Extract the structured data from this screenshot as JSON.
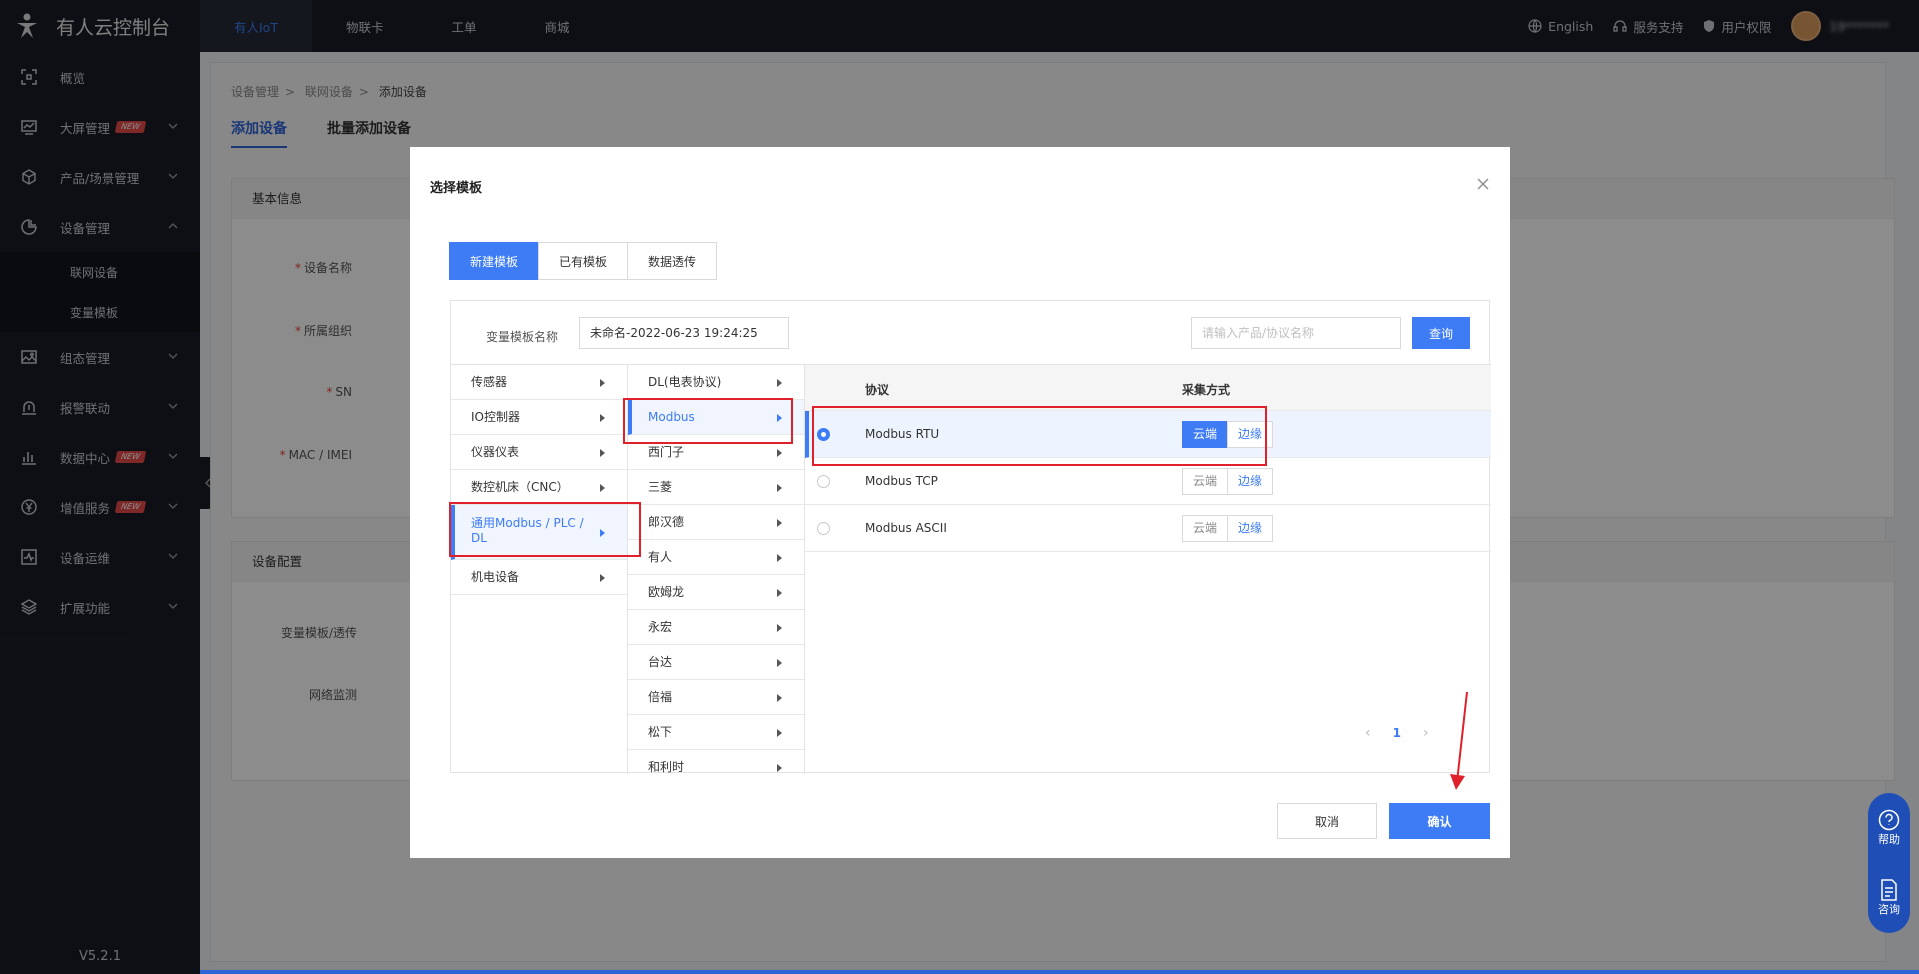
{
  "app": {
    "title": "有人云控制台",
    "version": "V5.2.1"
  },
  "topnav": {
    "tabs": [
      "有人IoT",
      "物联卡",
      "工单",
      "商城"
    ],
    "language": "English",
    "support": "服务支持",
    "permissions": "用户权限",
    "username": "19*******"
  },
  "sidebar": {
    "new_badge": "NEW",
    "items": [
      {
        "label": "概览"
      },
      {
        "label": "大屏管理"
      },
      {
        "label": "产品/场景管理"
      },
      {
        "label": "设备管理"
      },
      {
        "label": "组态管理"
      },
      {
        "label": "报警联动"
      },
      {
        "label": "数据中心"
      },
      {
        "label": "增值服务"
      },
      {
        "label": "设备运维"
      },
      {
        "label": "扩展功能"
      }
    ],
    "submenu": [
      "联网设备",
      "变量模板"
    ]
  },
  "page": {
    "breadcrumb": [
      "设备管理",
      "联网设备",
      "添加设备"
    ],
    "tabs": [
      "添加设备",
      "批量添加设备"
    ],
    "basic_info_title": "基本信息",
    "fields": [
      "设备名称",
      "所属组织",
      "SN",
      "MAC / IMEI"
    ],
    "device_config_title": "设备配置",
    "config_fields": [
      "变量模板/透传",
      "网络监测"
    ]
  },
  "modal": {
    "title": "选择模板",
    "segments": [
      "新建模板",
      "已有模板",
      "数据透传"
    ],
    "template_name_label": "变量模板名称",
    "template_name_value": "未命名-2022-06-23 19:24:25",
    "search_placeholder": "请输入产品/协议名称",
    "query_label": "查询",
    "categories": [
      "传感器",
      "IO控制器",
      "仪器仪表",
      "数控机床（CNC）",
      "通用Modbus / PLC / DL",
      "机电设备"
    ],
    "brands": [
      "DL(电表协议)",
      "Modbus",
      "西门子",
      "三菱",
      "郎汉德",
      "有人",
      "欧姆龙",
      "永宏",
      "台达",
      "倍福",
      "松下",
      "和利时"
    ],
    "table_headers": {
      "protocol": "协议",
      "mode": "采集方式"
    },
    "rows": [
      {
        "protocol": "Modbus RTU",
        "cloud": "云端",
        "edge": "边缘"
      },
      {
        "protocol": "Modbus TCP",
        "cloud": "云端",
        "edge": "边缘"
      },
      {
        "protocol": "Modbus ASCII",
        "cloud": "云端",
        "edge": "边缘"
      }
    ],
    "page_number": "1",
    "cancel_label": "取消",
    "confirm_label": "确认"
  },
  "float_help": {
    "help": "帮助",
    "consult": "咨询"
  },
  "colors": {
    "accent": "#3d7cf5",
    "sidebar": "#1a1d26",
    "annotation": "#e0202a"
  }
}
